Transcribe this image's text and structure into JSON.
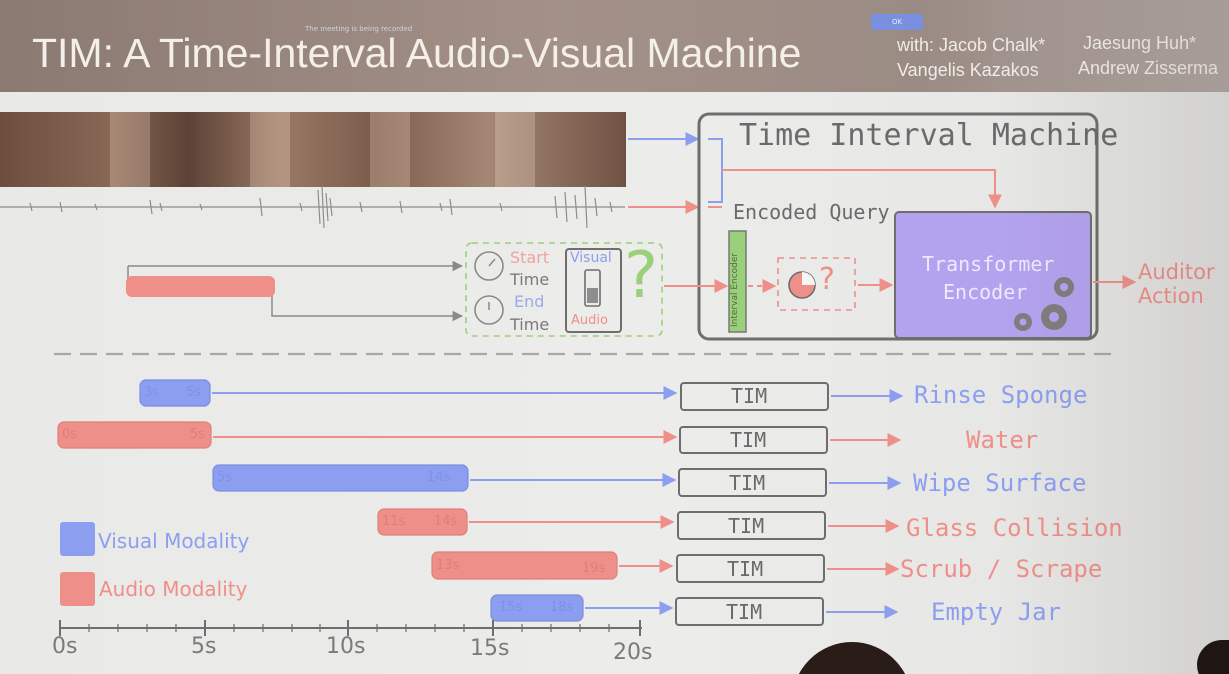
{
  "topbar": {
    "recording_notice": "The meeting is being recorded",
    "ok_label": "OK",
    "title": "TIM: A Time-Interval Audio-Visual Machine",
    "authors": [
      "with: Jacob Chalk*",
      "Jaesung Huh*",
      "Vangelis Kazakos",
      "Andrew Zisserma"
    ]
  },
  "diagram": {
    "machine_label": "Time Interval Machine",
    "encoded_query_label": "Encoded Query",
    "interval_encoder_label": "Interval Encoder",
    "transformer_label_line1": "Transformer",
    "transformer_label_line2": "Encoder",
    "query_start_label": "Start",
    "query_time_label": "Time",
    "query_end_label": "End",
    "query_time_label2": "Time",
    "modality_visual": "Visual",
    "modality_audio": "Audio",
    "question_mark": "?",
    "output_line1": "Auditor",
    "output_line2": "Action",
    "colors": {
      "visual": "#8c9ef0",
      "audio": "#ef8f8a",
      "transformer": "#b3a2ee",
      "encoder_green": "#9bd07a"
    }
  },
  "timeline": {
    "tim_label": "TIM",
    "rows": [
      {
        "start": "3s",
        "end": "5s",
        "modality": "visual",
        "label": "Rinse Sponge"
      },
      {
        "start": "0s",
        "end": "5s",
        "modality": "audio",
        "label": "Water"
      },
      {
        "start": "5s",
        "end": "14s",
        "modality": "visual",
        "label": "Wipe Surface"
      },
      {
        "start": "11s",
        "end": "14s",
        "modality": "audio",
        "label": "Glass Collision"
      },
      {
        "start": "13s",
        "end": "19s",
        "modality": "audio",
        "label": "Scrub / Scrape"
      },
      {
        "start": "15s",
        "end": "18s",
        "modality": "visual",
        "label": "Empty Jar"
      }
    ],
    "legend": {
      "visual": "Visual Modality",
      "audio": "Audio Modality"
    },
    "axis_ticks": [
      "0s",
      "5s",
      "10s",
      "15s",
      "20s"
    ]
  }
}
